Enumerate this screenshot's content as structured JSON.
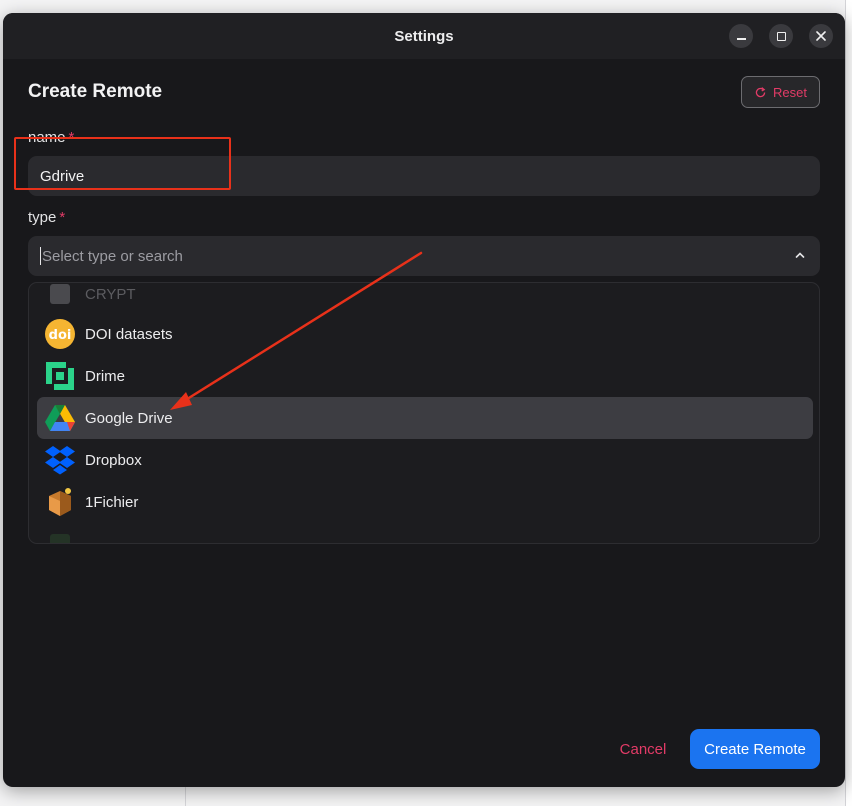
{
  "window": {
    "title": "Settings"
  },
  "form": {
    "heading": "Create Remote",
    "reset_label": "Reset",
    "name_label": "name",
    "name_value": "Gdrive",
    "type_label": "type",
    "required_mark": "*",
    "type_placeholder": "Select type or search"
  },
  "dropdown": {
    "options": [
      {
        "label": "CRYPT",
        "icon": "crypt-icon"
      },
      {
        "label": "DOI datasets",
        "icon": "doi-icon"
      },
      {
        "label": "Drime",
        "icon": "drime-icon"
      },
      {
        "label": "Google Drive",
        "icon": "google-drive-icon",
        "selected": true
      },
      {
        "label": "Dropbox",
        "icon": "dropbox-icon"
      },
      {
        "label": "1Fichier",
        "icon": "1fichier-icon"
      }
    ]
  },
  "footer": {
    "cancel_label": "Cancel",
    "create_label": "Create Remote"
  },
  "annotations": {
    "highlight_color": "#e8311a"
  },
  "colors": {
    "accent": "#1b74f0",
    "danger": "#e23b67",
    "background": "#18181b"
  }
}
